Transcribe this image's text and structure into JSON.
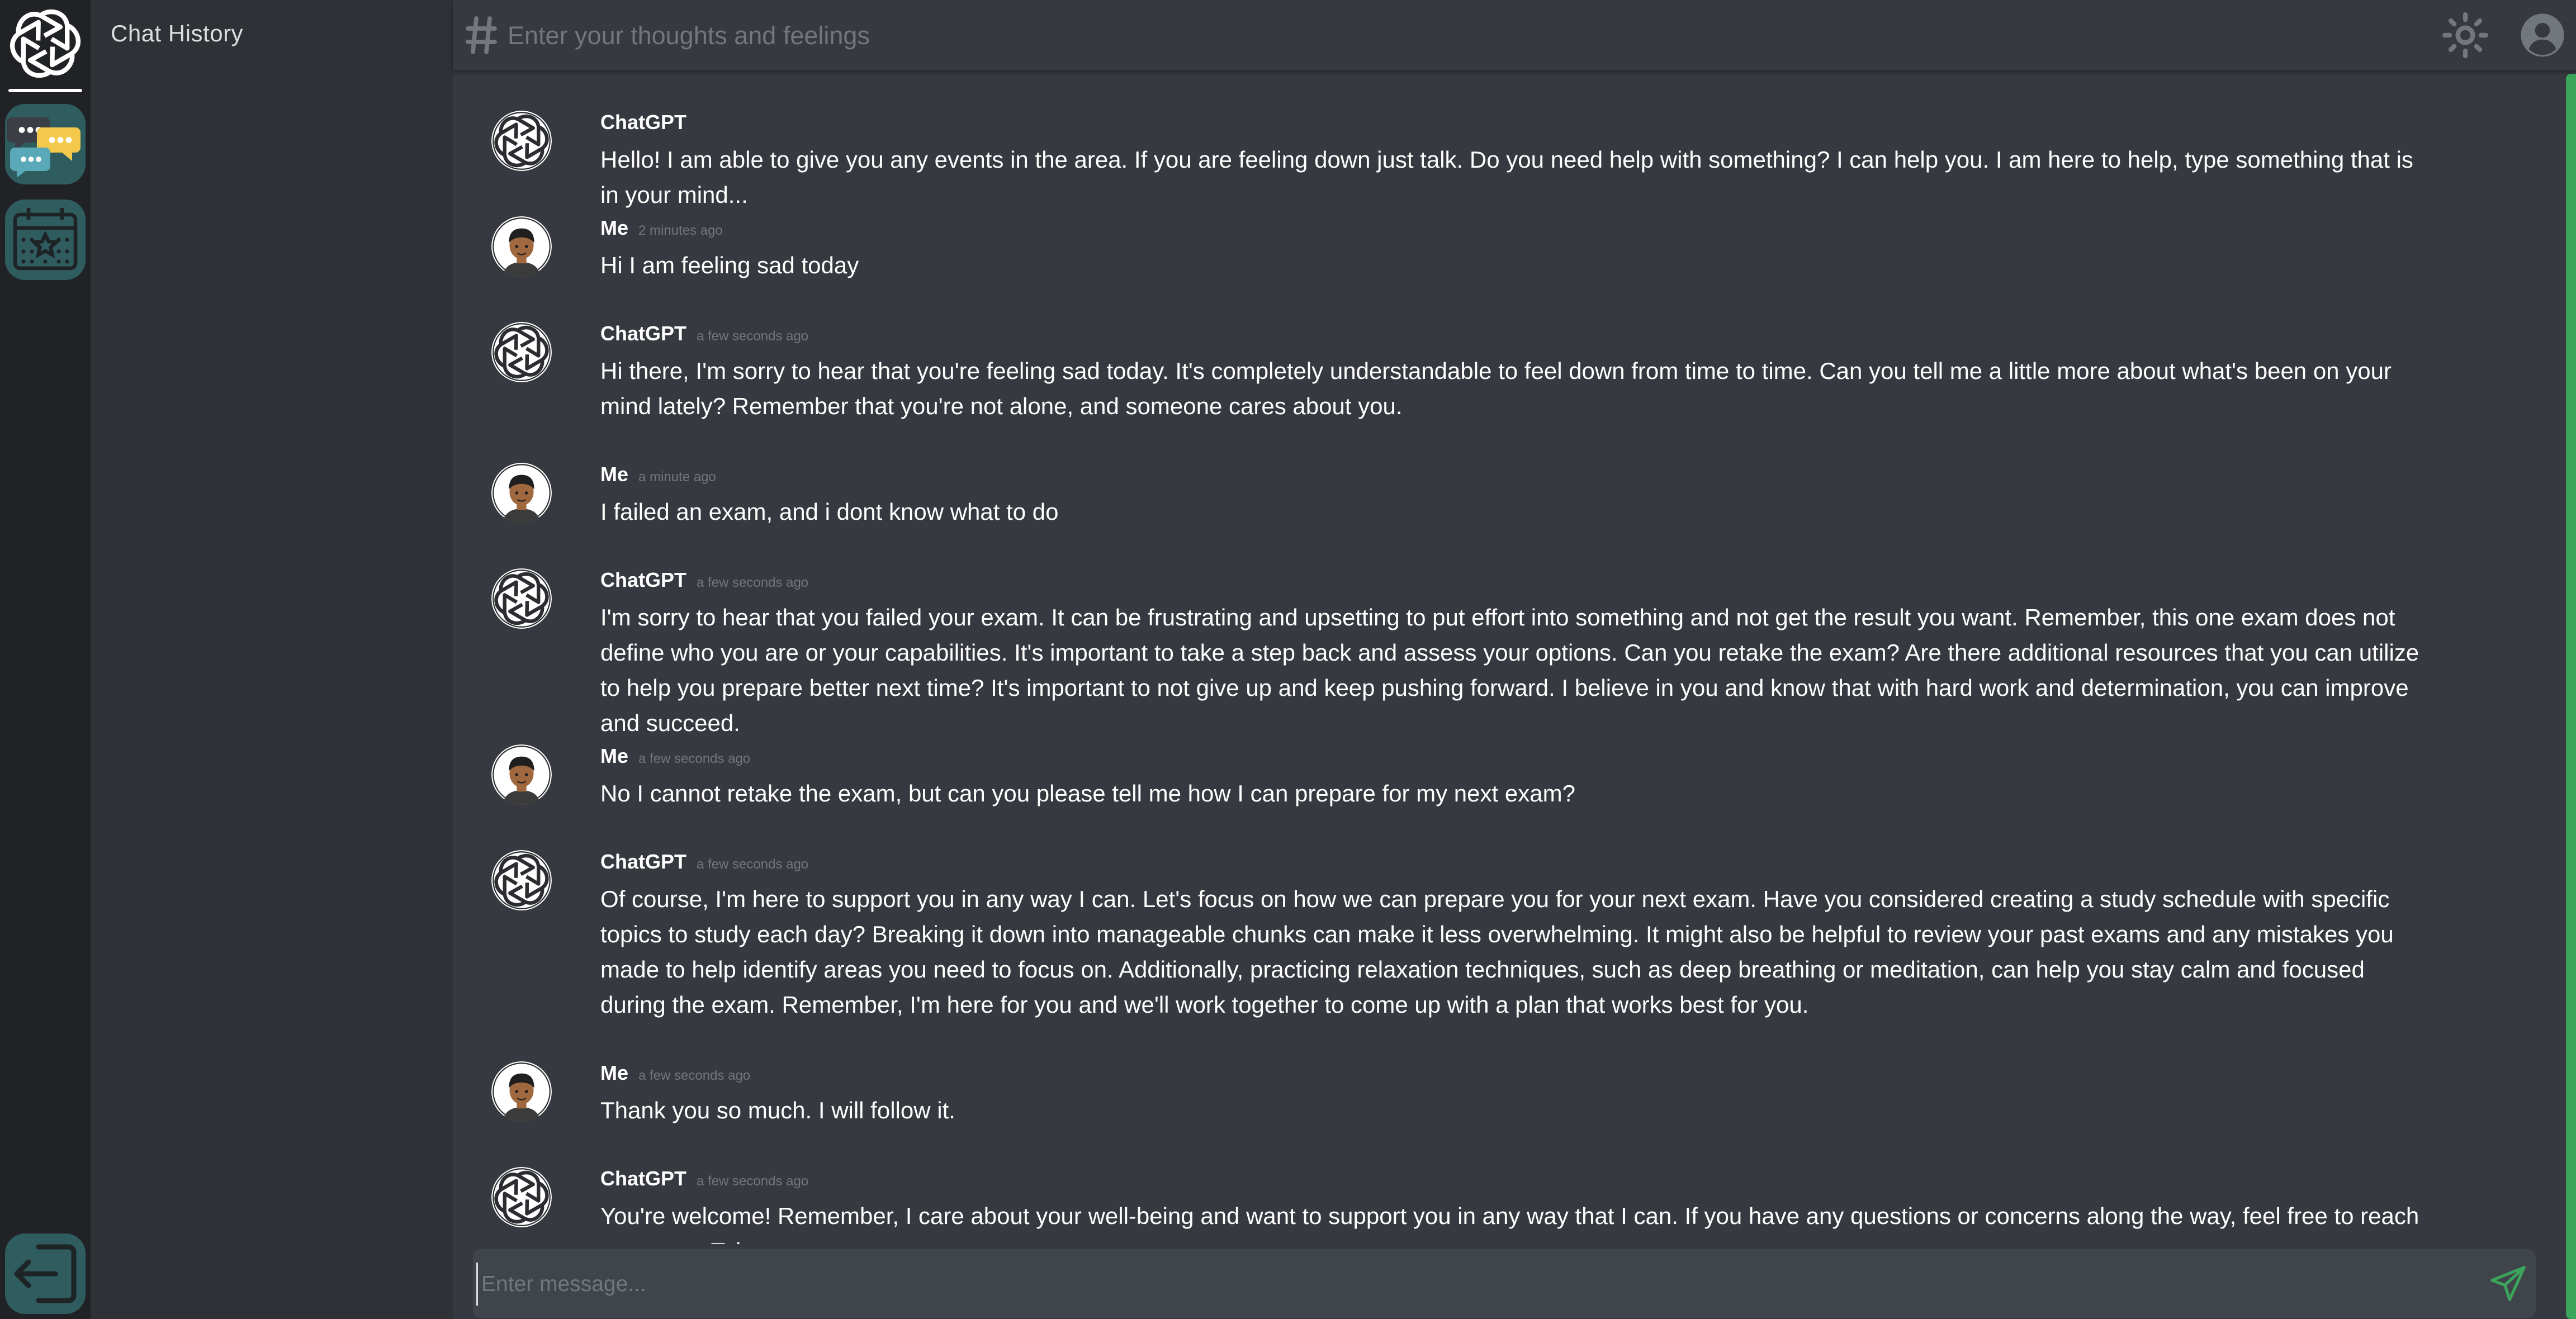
{
  "sidebar": {
    "title": "Chat History",
    "rail_items": [
      {
        "icon": "openai-logo-icon"
      },
      {
        "icon": "chat-bubbles-icon"
      },
      {
        "icon": "calendar-icon"
      },
      {
        "icon": "logout-icon"
      }
    ]
  },
  "header": {
    "channel_icon": "hash-icon",
    "placeholder": "Enter your thoughts and feelings",
    "theme_icon": "sun-icon",
    "profile_icon": "user-circle-icon"
  },
  "messages": [
    {
      "author": "ChatGPT",
      "time": "",
      "avatar": "openai-logo-icon",
      "text": "Hello! I am able to give you any events in the area. If you are feeling down just talk. Do you need help with something? I can help you. I am here to help, type something that is in your mind..."
    },
    {
      "author": "Me",
      "time": "2 minutes ago",
      "avatar": "user-avatar-icon",
      "text": "Hi I am feeling sad today"
    },
    {
      "author": "ChatGPT",
      "time": "a few seconds ago",
      "avatar": "openai-logo-icon",
      "text": "Hi there, I'm sorry to hear that you're feeling sad today. It's completely understandable to feel down from time to time. Can you tell me a little more about what's been on your mind lately? Remember that you're not alone, and someone cares about you."
    },
    {
      "author": "Me",
      "time": "a minute ago",
      "avatar": "user-avatar-icon",
      "text": "I failed an exam, and i dont know what to do"
    },
    {
      "author": "ChatGPT",
      "time": "a few seconds ago",
      "avatar": "openai-logo-icon",
      "text": "I'm sorry to hear that you failed your exam. It can be frustrating and upsetting to put effort into something and not get the result you want. Remember, this one exam does not define who you are or your capabilities. It's important to take a step back and assess your options. Can you retake the exam? Are there additional resources that you can utilize to help you prepare better next time? It's important to not give up and keep pushing forward. I believe in you and know that with hard work and determination, you can improve and succeed."
    },
    {
      "author": "Me",
      "time": "a few seconds ago",
      "avatar": "user-avatar-icon",
      "text": "No I cannot retake the exam, but can you please tell me how I can prepare for my next exam?"
    },
    {
      "author": "ChatGPT",
      "time": "a few seconds ago",
      "avatar": "openai-logo-icon",
      "text": "Of course, I'm here to support you in any way I can. Let's focus on how we can prepare you for your next exam. Have you considered creating a study schedule with specific topics to study each day? Breaking it down into manageable chunks can make it less overwhelming. It might also be helpful to review your past exams and any mistakes you made to help identify areas you need to focus on. Additionally, practicing relaxation techniques, such as deep breathing or meditation, can help you stay calm and focused during the exam. Remember, I'm here for you and we'll work together to come up with a plan that works best for you."
    },
    {
      "author": "Me",
      "time": "a few seconds ago",
      "avatar": "user-avatar-icon",
      "text": "Thank you so much. I will follow it."
    },
    {
      "author": "ChatGPT",
      "time": "a few seconds ago",
      "avatar": "openai-logo-icon",
      "text": "You're welcome! Remember, I care about your well-being and want to support you in any way that I can. If you have any questions or concerns along the way, feel free to reach out to me. Take care."
    }
  ],
  "composer": {
    "placeholder": "Enter message...",
    "send_icon": "send-icon"
  },
  "colors": {
    "rail_bg": "#202225",
    "history_bg": "#2f3136",
    "main_bg": "#36393f",
    "composer_bg": "#40444b",
    "accent_teal": "#2f5c5e",
    "scroll_green": "#3ba55c"
  }
}
